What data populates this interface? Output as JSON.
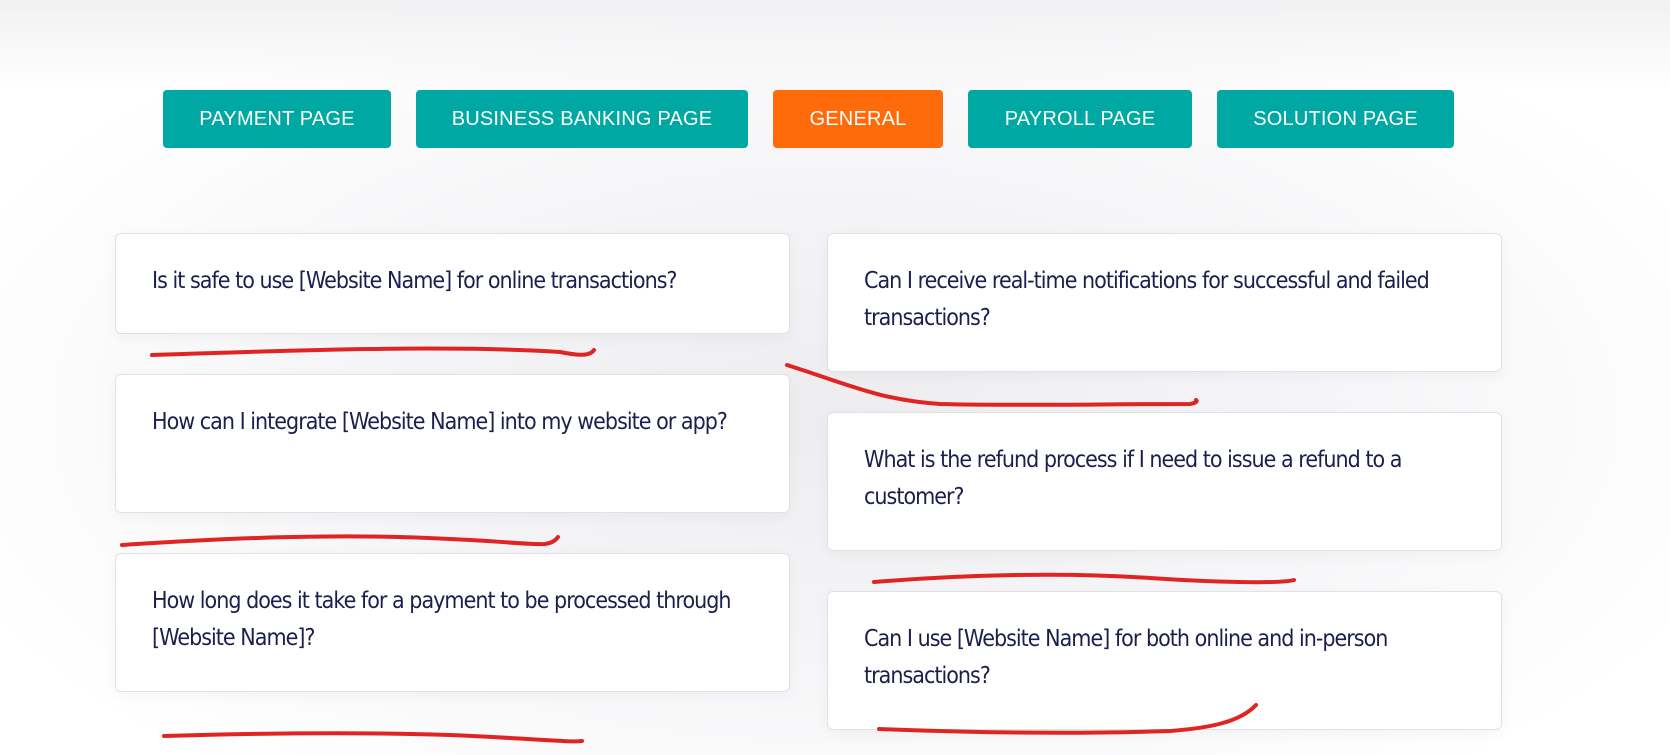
{
  "tabs": [
    {
      "label": "PAYMENT PAGE",
      "active": false
    },
    {
      "label": "BUSINESS BANKING PAGE",
      "active": false
    },
    {
      "label": "GENERAL",
      "active": true
    },
    {
      "label": "PAYROLL PAGE",
      "active": false
    },
    {
      "label": "SOLUTION PAGE",
      "active": false
    }
  ],
  "faq": {
    "left": [
      "Is it safe to use [Website Name] for online transactions?",
      "How can I integrate [Website Name] into my website or app?",
      "How long does it take for a payment to be processed through [Website Name]?"
    ],
    "right": [
      "Can I receive real-time notifications for successful and failed transactions?",
      "What is the refund process if I need to issue a refund to a customer?",
      "Can I use [Website Name] for both online and in-person transactions?"
    ]
  },
  "colors": {
    "tab_teal": "#00a8a3",
    "tab_active": "#ff6a0a",
    "question_text": "#1c1f4d",
    "annotation_red": "#e02424"
  }
}
